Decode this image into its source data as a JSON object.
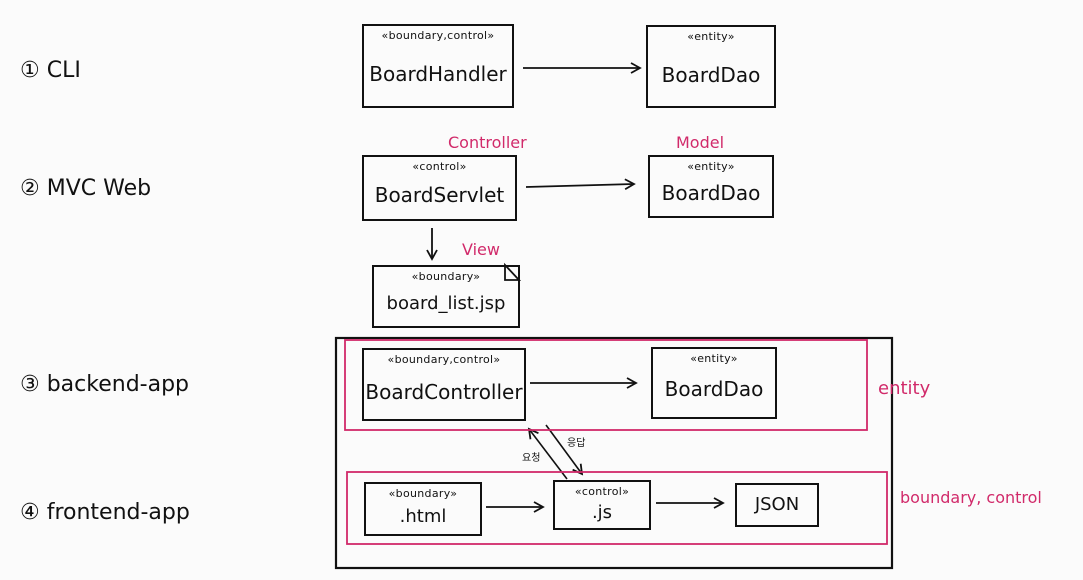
{
  "rows": [
    {
      "label": "① CLI"
    },
    {
      "label": "② MVC Web"
    },
    {
      "label": "③ backend-app"
    },
    {
      "label": "④ frontend-app"
    }
  ],
  "cli": {
    "handler": {
      "stereotype": "«boundary,control»",
      "name": "BoardHandler"
    },
    "dao": {
      "stereotype": "«entity»",
      "name": "BoardDao"
    }
  },
  "mvc": {
    "servlet": {
      "stereotype": "«control»",
      "name": "BoardServlet"
    },
    "dao": {
      "stereotype": "«entity»",
      "name": "BoardDao"
    },
    "jsp": {
      "stereotype": "«boundary»",
      "name": "board_list.jsp"
    },
    "controller_note": "Controller",
    "model_note": "Model",
    "view_note": "View"
  },
  "backend": {
    "controller": {
      "stereotype": "«boundary,control»",
      "name": "BoardController"
    },
    "dao": {
      "stereotype": "«entity»",
      "name": "BoardDao"
    },
    "group_note": "entity"
  },
  "frontend": {
    "html": {
      "stereotype": "«boundary»",
      "name": ".html"
    },
    "js": {
      "stereotype": "«control»",
      "name": ".js"
    },
    "json": {
      "name": "JSON"
    },
    "group_note": "boundary, control"
  },
  "request_labels": {
    "request": "요청",
    "response": "응답"
  },
  "colors": {
    "ink": "#111111",
    "annotation": "#d12a6a",
    "background": "#fbfbfb"
  }
}
